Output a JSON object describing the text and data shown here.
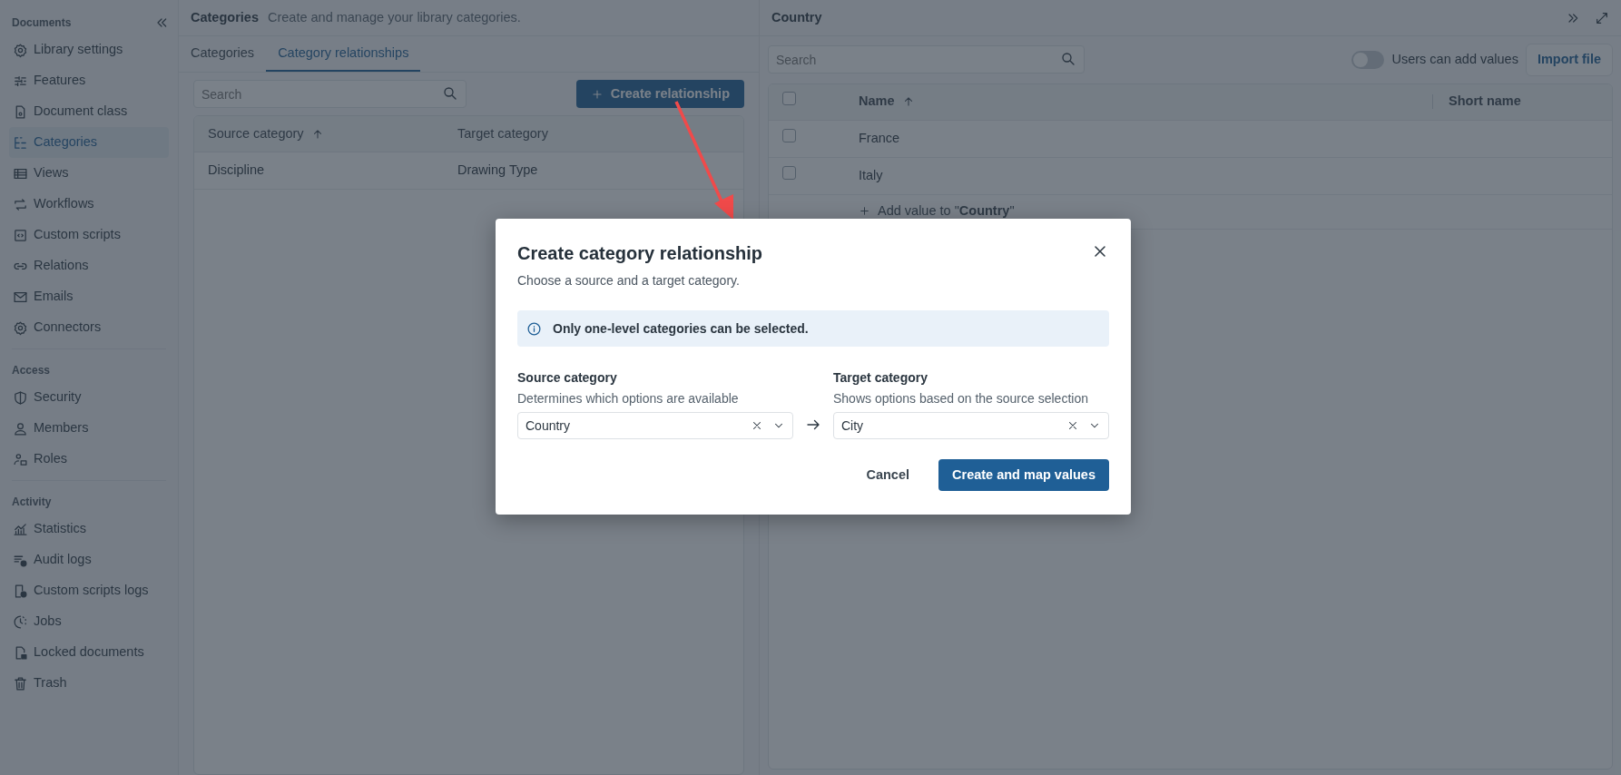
{
  "sidebar": {
    "sections": [
      {
        "title": "Documents",
        "items": [
          {
            "label": "Library settings",
            "selected": false
          },
          {
            "label": "Features",
            "selected": false
          },
          {
            "label": "Document class",
            "selected": false
          },
          {
            "label": "Categories",
            "selected": true
          },
          {
            "label": "Views",
            "selected": false
          },
          {
            "label": "Workflows",
            "selected": false
          },
          {
            "label": "Custom scripts",
            "selected": false
          },
          {
            "label": "Relations",
            "selected": false
          },
          {
            "label": "Emails",
            "selected": false
          },
          {
            "label": "Connectors",
            "selected": false
          }
        ]
      },
      {
        "title": "Access",
        "items": [
          {
            "label": "Security",
            "selected": false
          },
          {
            "label": "Members",
            "selected": false
          },
          {
            "label": "Roles",
            "selected": false
          }
        ]
      },
      {
        "title": "Activity",
        "items": [
          {
            "label": "Statistics",
            "selected": false
          },
          {
            "label": "Audit logs",
            "selected": false
          },
          {
            "label": "Custom scripts logs",
            "selected": false
          },
          {
            "label": "Jobs",
            "selected": false
          },
          {
            "label": "Locked documents",
            "selected": false
          },
          {
            "label": "Trash",
            "selected": false
          }
        ]
      }
    ]
  },
  "main": {
    "title": "Categories",
    "subtitle": "Create and manage your library categories.",
    "tabs": [
      {
        "label": "Categories",
        "selected": false
      },
      {
        "label": "Category relationships",
        "selected": true
      }
    ],
    "search": {
      "placeholder": "Search"
    },
    "create_button": "Create relationship",
    "table": {
      "columns": [
        "Source category",
        "Target category"
      ],
      "rows": [
        [
          "Discipline",
          "Drawing Type"
        ]
      ]
    }
  },
  "detail": {
    "title": "Country",
    "search": {
      "placeholder": "Search"
    },
    "toggle": {
      "label": "Users can add values",
      "on": false
    },
    "import_button": "Import file",
    "table": {
      "select_all": {
        "checked": false
      },
      "columns": [
        "Name",
        "Short name"
      ],
      "rows": [
        {
          "name": "France",
          "checked": false
        },
        {
          "name": "Italy",
          "checked": false
        }
      ],
      "add_row": "Add value to \"**Country**\""
    }
  },
  "dialog": {
    "title": "Create category relationship",
    "subtitle": "Choose a source and a target category.",
    "info": "Only one-level categories can be selected.",
    "fields": [
      {
        "label": "Source category",
        "hint": "Determines which options are available",
        "value": "Country"
      },
      {
        "label": "Target category",
        "hint": "Shows options based on the source selection",
        "value": "City"
      }
    ],
    "buttons": [
      {
        "label": "Cancel",
        "kind": "secondary"
      },
      {
        "label": "Create and map values",
        "kind": "primary"
      }
    ]
  }
}
